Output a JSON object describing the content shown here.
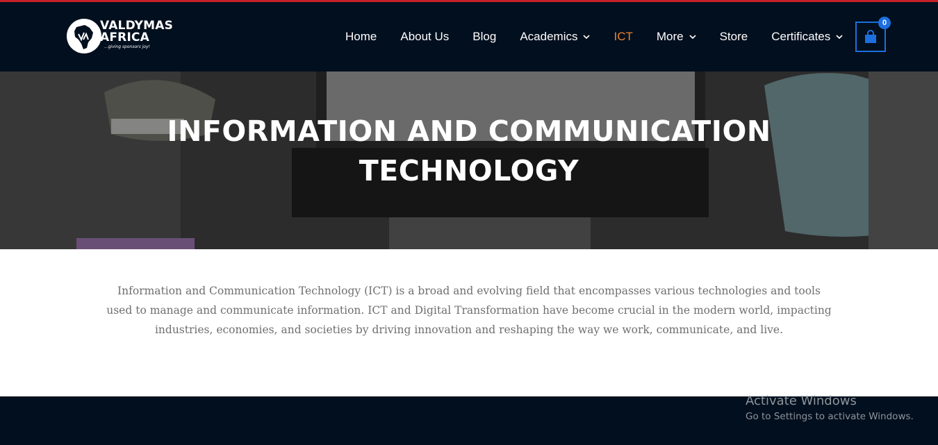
{
  "brand": {
    "name_line1": "VALDYMAS",
    "name_line2": "AFRICA",
    "tagline": "...giving sponsors joy!"
  },
  "nav": {
    "items": [
      {
        "label": "Home",
        "dropdown": false
      },
      {
        "label": "About Us",
        "dropdown": false
      },
      {
        "label": "Blog",
        "dropdown": false
      },
      {
        "label": "Academics",
        "dropdown": true
      },
      {
        "label": "ICT",
        "dropdown": false,
        "active": true
      },
      {
        "label": "More",
        "dropdown": true
      },
      {
        "label": "Store",
        "dropdown": false
      },
      {
        "label": "Certificates",
        "dropdown": true
      }
    ]
  },
  "cart": {
    "count": "0",
    "icon": "shopping-bag-icon"
  },
  "hero": {
    "title_line1": "INFORMATION AND COMMUNICATION",
    "title_line2": "TECHNOLOGY"
  },
  "intro": {
    "text": "Information and Communication Technology (ICT) is a broad and evolving field that encompasses various technologies and tools used to manage and communicate information. ICT and Digital Transformation have become crucial in the modern world, impacting industries, economies, and societies by driving innovation and reshaping the way we work, communicate, and live."
  },
  "windows_watermark": {
    "title": "Activate Windows",
    "subtitle": "Go to Settings to activate Windows."
  },
  "colors": {
    "header_bg": "#020f1e",
    "accent_active": "#e9822f",
    "cart_blue": "#1d6fe0",
    "top_accent": "#c8202a"
  }
}
